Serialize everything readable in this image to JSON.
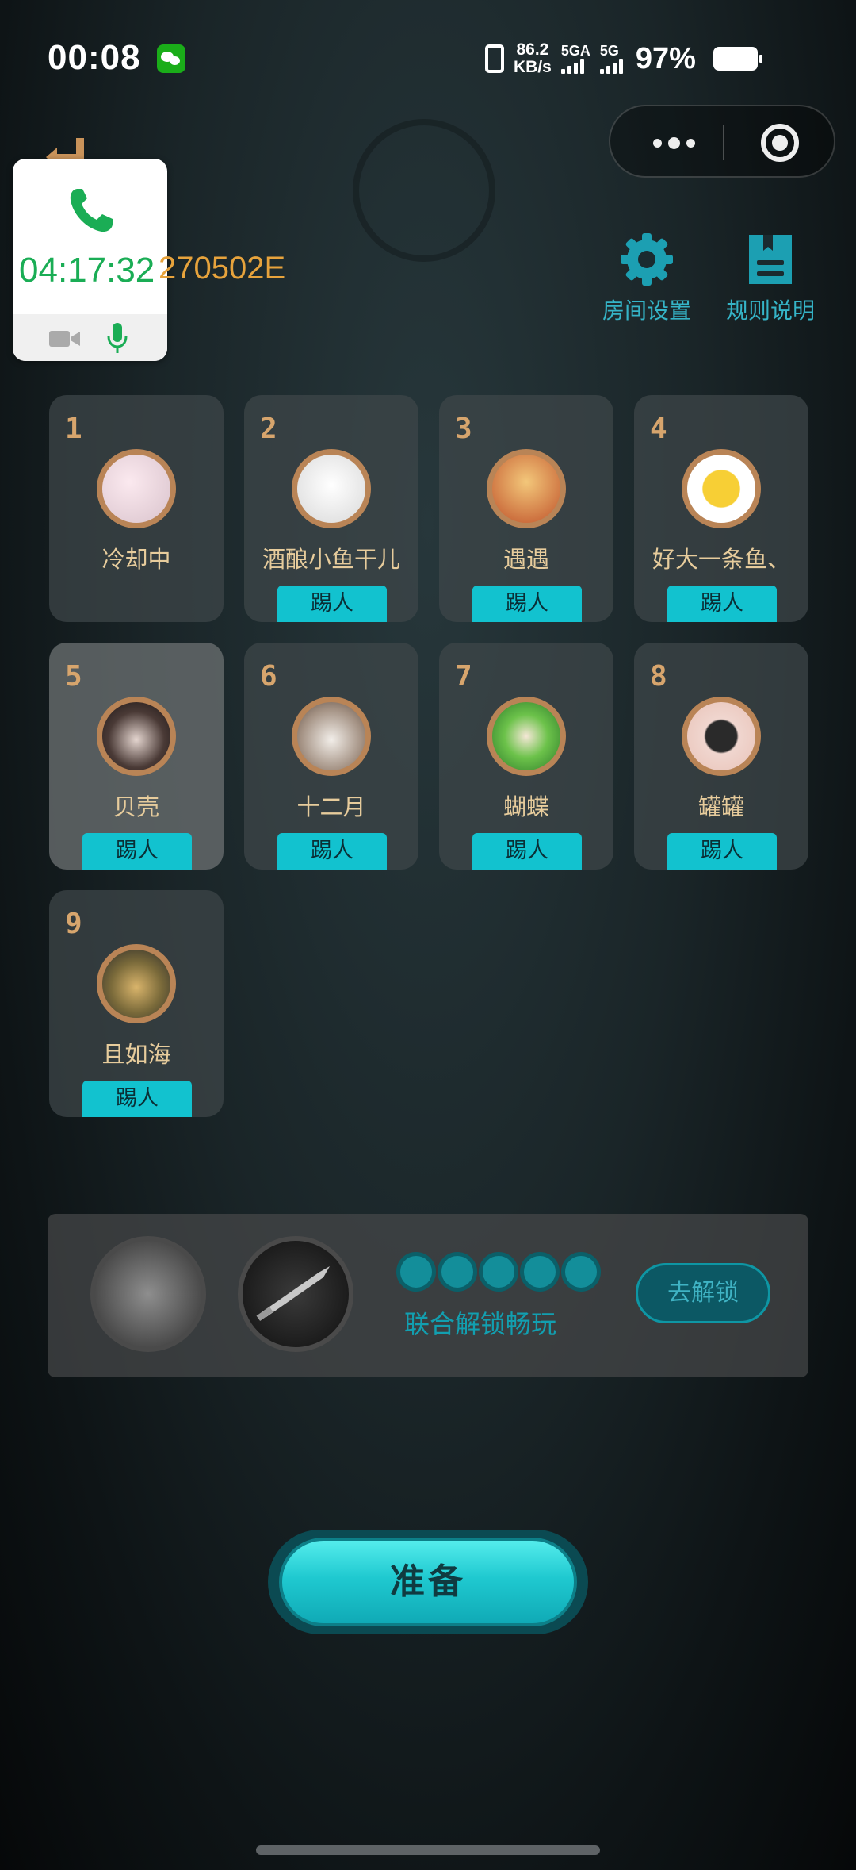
{
  "status_bar": {
    "time": "00:08",
    "net_speed_value": "86.2",
    "net_speed_unit": "KB/s",
    "sim1_label": "5GA",
    "sim2_label": "5G",
    "battery_percent": "97%"
  },
  "call_overlay": {
    "timer": "04:17:32"
  },
  "room": {
    "id_suffix": "270502E"
  },
  "top_buttons": {
    "room_settings": "房间设置",
    "rules": "规则说明"
  },
  "seats": [
    {
      "number": "1",
      "nickname": "冷却中",
      "kick_label": ""
    },
    {
      "number": "2",
      "nickname": "酒酿小鱼干儿",
      "kick_label": "踢人"
    },
    {
      "number": "3",
      "nickname": "遇遇",
      "kick_label": "踢人"
    },
    {
      "number": "4",
      "nickname": "好大一条鱼、",
      "kick_label": "踢人"
    },
    {
      "number": "5",
      "nickname": "贝壳",
      "kick_label": "踢人"
    },
    {
      "number": "6",
      "nickname": "十二月",
      "kick_label": "踢人"
    },
    {
      "number": "7",
      "nickname": "蝴蝶",
      "kick_label": "踢人"
    },
    {
      "number": "8",
      "nickname": "罐罐",
      "kick_label": "踢人"
    },
    {
      "number": "9",
      "nickname": "且如海",
      "kick_label": "踢人"
    }
  ],
  "unlock_panel": {
    "caption": "联合解锁畅玩",
    "button": "去解锁",
    "progress_dots": 5
  },
  "ready_button": "准备",
  "colors": {
    "accent": "#12c2cf",
    "seat_number": "#d7a56d",
    "nickname": "#e7cc9c",
    "room_id": "#e7a33c",
    "call_green": "#1aad55"
  }
}
